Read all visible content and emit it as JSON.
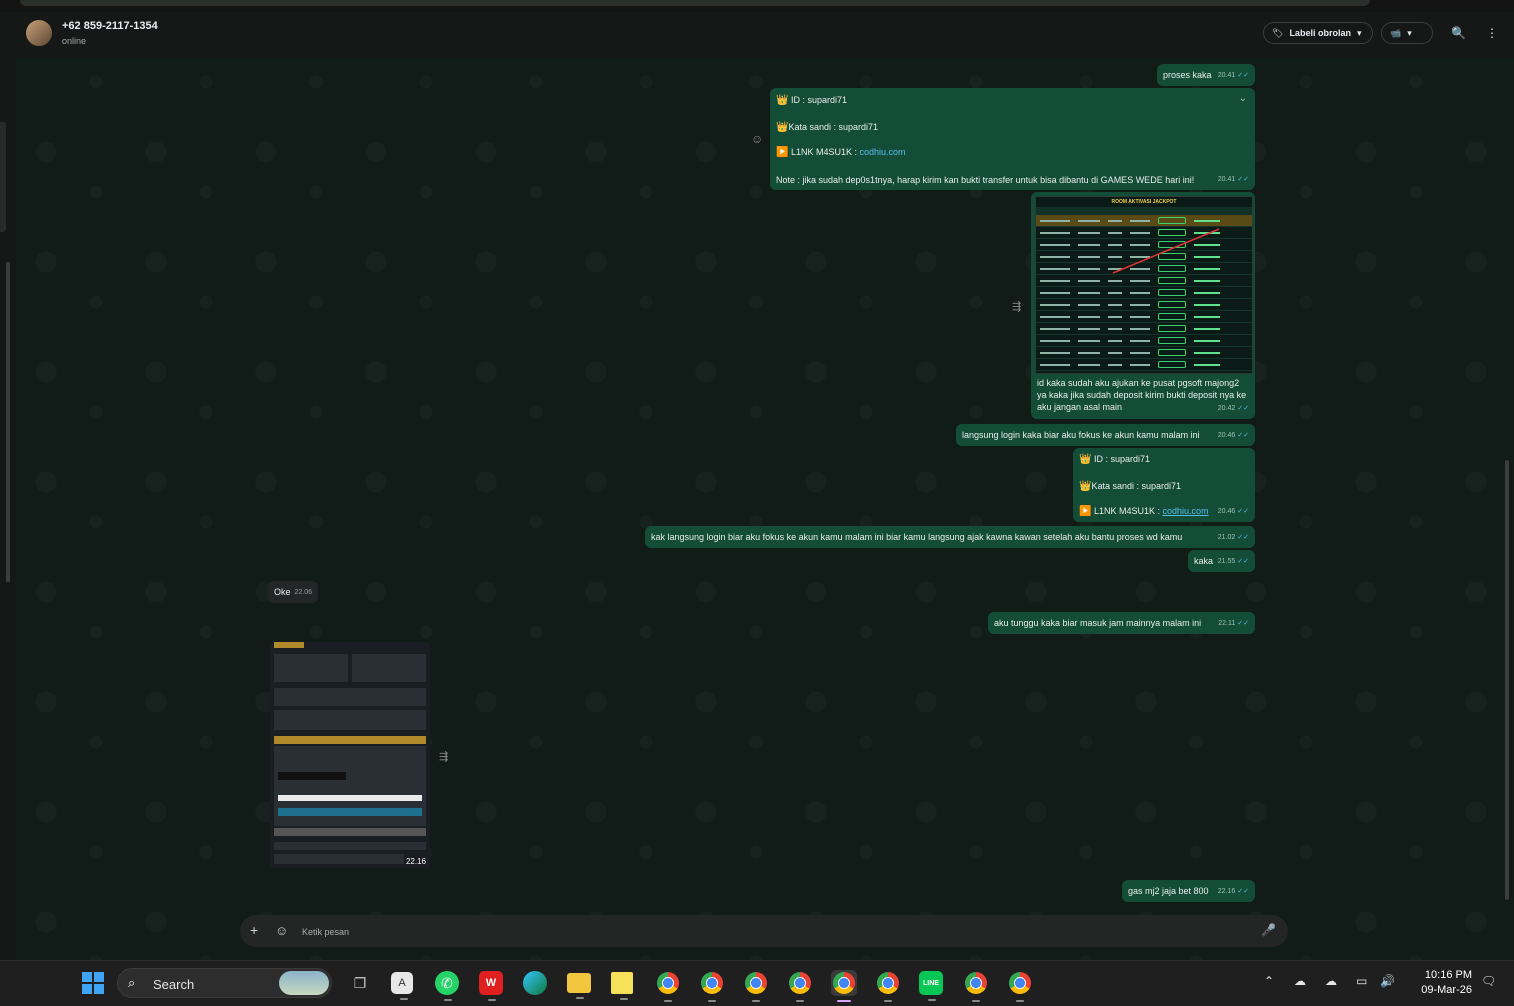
{
  "header": {
    "contact_name": "+62 859-2117-1354",
    "status": "online",
    "label_button": "Labeli obrolan",
    "icons": [
      "label-icon",
      "chevron-down-icon",
      "video-call-icon",
      "search-icon",
      "more-options-icon"
    ]
  },
  "messages": {
    "m1": {
      "text": "proses kaka",
      "time": "20.41"
    },
    "m2": {
      "line1": "ID :  supardi71",
      "line2": "Kata sandi : supardi71",
      "line3_label": "L1NK M4SU1K : ",
      "line3_link": "codhiu.com",
      "line4": "Note : jika sudah dep0s1tnya, harap kirim kan bukti transfer untuk bisa dibantu di GAMES WEDE hari ini!",
      "time": "20.41"
    },
    "m3": {
      "image_title": "ROOM AKTIVASI JACKPOT",
      "caption": "id kaka sudah aku ajukan ke pusat pgsoft majong2 ya kaka jika sudah deposit kirim bukti deposit nya ke aku jangan asal main",
      "time": "20.42"
    },
    "m4": {
      "text": "langsung login kaka biar aku fokus ke akun kamu malam ini",
      "time": "20.46"
    },
    "m5": {
      "line1": "ID :  supardi71",
      "line2": "Kata sandi : supardi71",
      "line3_label": "L1NK M4SU1K : ",
      "line3_link": "codhiu.com",
      "time": "20.46"
    },
    "m6": {
      "text": "kak langsung login biar aku fokus ke akun kamu malam ini biar kamu langsung ajak kawna kawan setelah aku bantu proses wd kamu",
      "time": "21.02"
    },
    "m7": {
      "text": "kaka",
      "time": "21.55"
    },
    "m8": {
      "text": "Oke",
      "time": "22.06"
    },
    "m9": {
      "text": "aku tunggu kaka biar masuk jam mainnya malam ini",
      "time": "22.11"
    },
    "m10": {
      "time": "22.16"
    },
    "m11": {
      "text": "gas mj2 jaja bet 800",
      "time": "22.16"
    }
  },
  "composer": {
    "placeholder": "Ketik pesan"
  },
  "taskbar": {
    "search_label": "Search",
    "clock_time": "10:16 PM",
    "clock_date": "09-Mar-26"
  },
  "colors": {
    "outgoing": "#144d37",
    "incoming": "#232626",
    "link": "#53bdeb",
    "chat_bg": "#111b17"
  }
}
